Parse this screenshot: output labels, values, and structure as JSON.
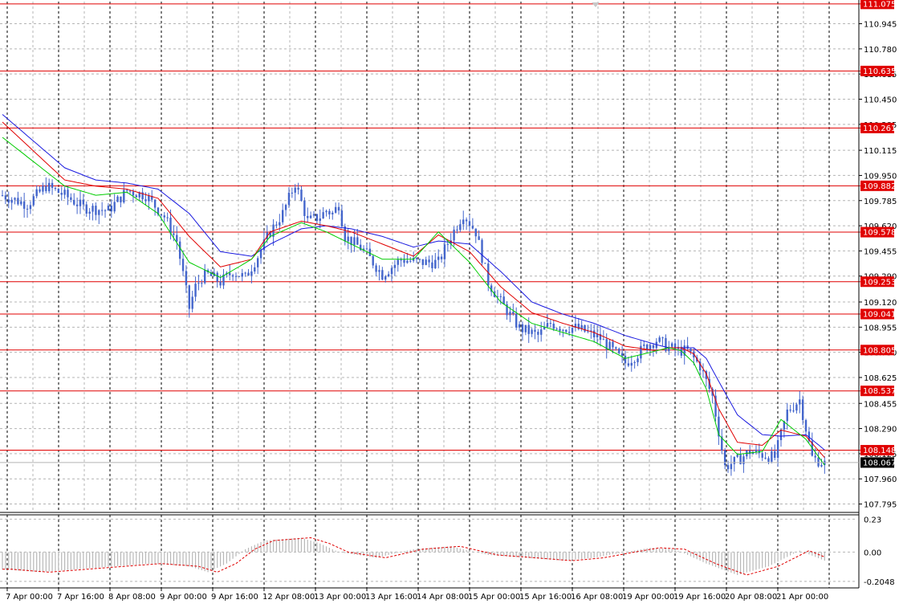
{
  "chart_data": [
    {
      "type": "line",
      "title": "",
      "xlabel": "",
      "ylabel": "",
      "ylim": [
        107.74,
        111.09
      ],
      "grid": true,
      "y_ticks": [
        "110.945",
        "110.780",
        "110.615",
        "110.450",
        "110.285",
        "110.115",
        "109.950",
        "109.785",
        "109.620",
        "109.455",
        "109.290",
        "109.120",
        "108.955",
        "108.790",
        "108.625",
        "108.455",
        "108.290",
        "108.125",
        "107.960",
        "107.795"
      ],
      "x_ticks": [
        "7 Apr 00:00",
        "7 Apr 16:00",
        "8 Apr 08:00",
        "9 Apr 00:00",
        "9 Apr 16:00",
        "12 Apr 08:00",
        "13 Apr 00:00",
        "13 Apr 16:00",
        "14 Apr 08:00",
        "15 Apr 00:00",
        "15 Apr 16:00",
        "16 Apr 08:00",
        "19 Apr 00:00",
        "19 Apr 16:00",
        "20 Apr 08:00",
        "21 Apr 00:00"
      ],
      "horizontal_levels": [
        "111.075",
        "110.635",
        "110.261",
        "109.882",
        "109.578",
        "109.253",
        "109.041",
        "108.805",
        "108.537",
        "108.148"
      ],
      "current_price": "108.067",
      "price_anchors": {
        "x": [
          0,
          8,
          14,
          20,
          26,
          34,
          40,
          46,
          52,
          56,
          58,
          60,
          62,
          64,
          66,
          70,
          74,
          78,
          82,
          86,
          90,
          94,
          98,
          102,
          104,
          106,
          108,
          110,
          112,
          116,
          122,
          128,
          134,
          140,
          144,
          148,
          152,
          156,
          160,
          166,
          172,
          176,
          180,
          184,
          188,
          192,
          196,
          200,
          204,
          206,
          210,
          214,
          218,
          220,
          224,
          228,
          232,
          236,
          240,
          244,
          248,
          252,
          256,
          260,
          264
        ],
        "y": [
          109.82,
          109.76,
          109.88,
          109.82,
          109.74,
          109.72,
          109.85,
          109.82,
          109.68,
          109.52,
          109.3,
          109.08,
          109.22,
          109.28,
          109.3,
          109.25,
          109.32,
          109.28,
          109.42,
          109.58,
          109.7,
          109.9,
          109.65,
          109.68,
          109.72,
          109.7,
          109.76,
          109.55,
          109.52,
          109.46,
          109.3,
          109.4,
          109.38,
          109.38,
          109.55,
          109.7,
          109.58,
          109.25,
          109.12,
          108.95,
          108.9,
          108.98,
          108.95,
          108.95,
          108.92,
          108.88,
          108.8,
          108.72,
          108.78,
          108.82,
          108.87,
          108.82,
          108.8,
          108.8,
          108.7,
          108.5,
          108.04,
          108.08,
          108.14,
          108.12,
          108.1,
          108.4,
          108.48,
          108.1,
          108.06
        ]
      },
      "ma_anchors": {
        "x": [
          0,
          20,
          30,
          40,
          50,
          60,
          70,
          80,
          86,
          96,
          104,
          112,
          122,
          132,
          140,
          150,
          160,
          170,
          180,
          190,
          200,
          210,
          214,
          218,
          222,
          226,
          230,
          236,
          244,
          250,
          258,
          264
        ],
        "ma1": [
          110.2,
          109.88,
          109.82,
          109.84,
          109.7,
          109.38,
          109.28,
          109.4,
          109.55,
          109.64,
          109.58,
          109.5,
          109.4,
          109.4,
          109.58,
          109.38,
          109.12,
          108.98,
          108.92,
          108.86,
          108.75,
          108.8,
          108.82,
          108.8,
          108.72,
          108.55,
          108.25,
          108.12,
          108.14,
          108.35,
          108.22,
          108.05
        ],
        "ma2": [
          110.3,
          109.92,
          109.88,
          109.86,
          109.8,
          109.55,
          109.35,
          109.4,
          109.58,
          109.65,
          109.62,
          109.58,
          109.5,
          109.42,
          109.56,
          109.45,
          109.22,
          109.05,
          108.98,
          108.92,
          108.83,
          108.8,
          108.82,
          108.82,
          108.78,
          108.65,
          108.42,
          108.2,
          108.18,
          108.28,
          108.24,
          108.1
        ],
        "ma3": [
          110.35,
          110.0,
          109.92,
          109.9,
          109.86,
          109.7,
          109.45,
          109.42,
          109.5,
          109.6,
          109.62,
          109.6,
          109.55,
          109.48,
          109.52,
          109.5,
          109.32,
          109.12,
          109.04,
          108.98,
          108.9,
          108.84,
          108.82,
          108.82,
          108.82,
          108.75,
          108.6,
          108.38,
          108.25,
          108.24,
          108.25,
          108.15
        ]
      },
      "colors": {
        "candles": "#4466cc",
        "levels": "#e00000",
        "ma_fast": "#00cc00",
        "ma_mid": "#e00000",
        "ma_slow": "#1a1adf",
        "level_tag": "#e00000",
        "price_tag": "#000000"
      }
    },
    {
      "type": "line",
      "title": "",
      "xlabel": "",
      "ylabel": "",
      "ylim": [
        -0.25,
        0.26
      ],
      "y_ticks": [
        "0.23",
        "0.00",
        "-0.2048"
      ],
      "osc_anchors": {
        "x": [
          0,
          12,
          24,
          36,
          48,
          60,
          66,
          72,
          78,
          84,
          96,
          102,
          108,
          120,
          132,
          144,
          156,
          168,
          180,
          190,
          200,
          208,
          216,
          226,
          236,
          246,
          256,
          264
        ],
        "val": [
          -0.12,
          -0.14,
          -0.12,
          -0.1,
          -0.08,
          -0.1,
          -0.14,
          -0.08,
          0.02,
          0.08,
          0.1,
          0.06,
          0.0,
          -0.04,
          0.02,
          0.04,
          -0.02,
          -0.04,
          -0.06,
          -0.04,
          0.0,
          0.03,
          0.02,
          -0.08,
          -0.16,
          -0.1,
          0.01,
          -0.06
        ]
      },
      "colors": {
        "histogram": "#b8b8b8",
        "signal": "#e00000"
      }
    }
  ]
}
